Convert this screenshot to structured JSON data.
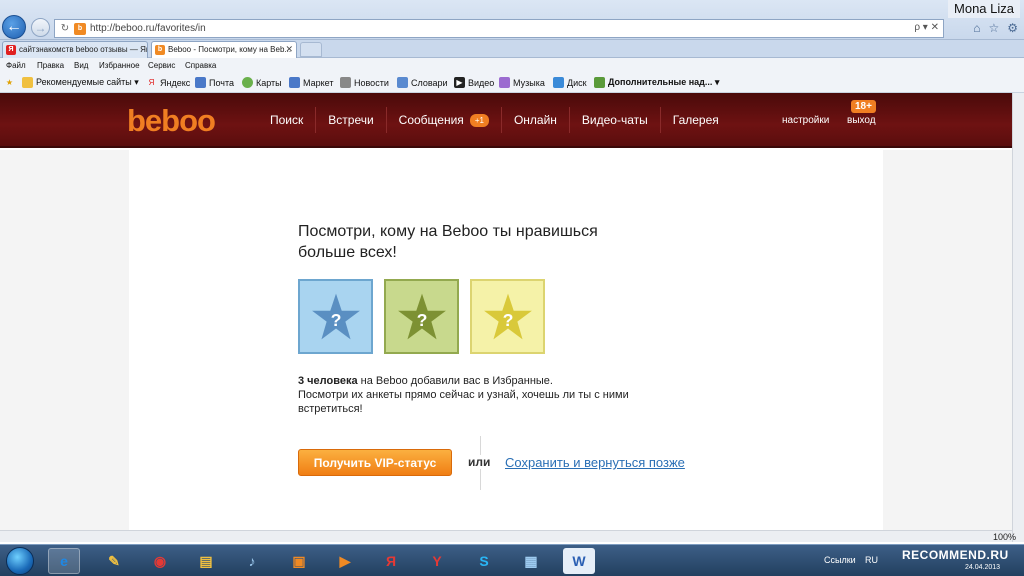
{
  "browser": {
    "user_label": "Mona Liza",
    "address_url": "http://beboo.ru/favorites/in",
    "address_search_hint": "ρ ▾ ✕",
    "tabs": [
      {
        "title": "сайтзнакомств beboo отзывы — Ян...",
        "fav": "Я",
        "fav_color": "#e02020"
      },
      {
        "title": "Beboo - Посмотри, кому на Beb...",
        "fav": "b",
        "fav_color": "#f08a24"
      }
    ],
    "menu": [
      "Файл",
      "Правка",
      "Вид",
      "Избранное",
      "Сервис",
      "Справка"
    ],
    "favorites": [
      {
        "label": "Рекомендуемые сайты ▾",
        "icon": "folder-icon"
      },
      {
        "label": "Яндекс",
        "icon": "yandex-icon"
      },
      {
        "label": "Почта",
        "icon": "mail-icon"
      },
      {
        "label": "Карты",
        "icon": "maps-icon"
      },
      {
        "label": "Маркет",
        "icon": "market-icon"
      },
      {
        "label": "Новости",
        "icon": "news-icon"
      },
      {
        "label": "Словари",
        "icon": "dict-icon"
      },
      {
        "label": "Видео",
        "icon": "video-icon"
      },
      {
        "label": "Музыка",
        "icon": "music-icon"
      },
      {
        "label": "Диск",
        "icon": "disk-icon"
      },
      {
        "label": "Дополнительные над... ▾",
        "icon": "addon-icon"
      }
    ],
    "zoom": "100%"
  },
  "site": {
    "logo": "beboo",
    "nav": [
      {
        "label": "Поиск"
      },
      {
        "label": "Встречи"
      },
      {
        "label": "Сообщения",
        "badge": "+1"
      },
      {
        "label": "Онлайн"
      },
      {
        "label": "Видео-чаты"
      },
      {
        "label": "Галерея"
      }
    ],
    "settings": "настройки",
    "age": "18+",
    "exit": "выход"
  },
  "main": {
    "heading": "Посмотри, кому на Beboo ты нравишься больше всех!",
    "info_count": "3 человека",
    "info_rest": " на Beboo добавили вас в Избранные.",
    "info_line2": "Посмотри их анкеты прямо сейчас и узнай, хочешь ли ты с ними встретиться!",
    "vip_button": "Получить VIP-статус",
    "or": "или",
    "save_link": "Сохранить и вернуться позже",
    "star_mark": "?"
  },
  "taskbar": {
    "tray_links": "Ссылки",
    "tray_lang": "RU",
    "watermark": "RECOMMEND.RU",
    "date": "24.04.2013"
  },
  "colors": {
    "accent": "#f07e22",
    "header_bg": "#6e1212",
    "link": "#2a6fb5"
  }
}
